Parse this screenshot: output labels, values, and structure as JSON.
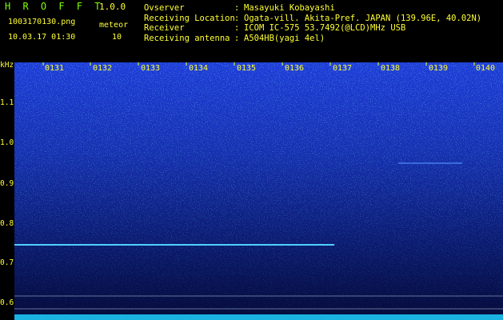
{
  "app": {
    "name": "H R O F F T",
    "version": "1.0.0"
  },
  "file": {
    "name": "1003170130.png",
    "datetime": "10.03.17 01:30"
  },
  "meteor": {
    "label": "meteor",
    "count": "10"
  },
  "info": [
    {
      "key": "Ovserver",
      "sep": ":",
      "value": "Masayuki Kobayashi"
    },
    {
      "key": "Receiving Location",
      "sep": ":",
      "value": "Ogata-vill. Akita-Pref. JAPAN (139.96E, 40.02N)"
    },
    {
      "key": "Receiver",
      "sep": ":",
      "value": "ICOM IC-575 53.7492(@LCD)MHz USB"
    },
    {
      "key": "Receiving antenna",
      "sep": ":",
      "value": "A504HB(yagi 4el)"
    }
  ],
  "yaxis": {
    "unit": "kHz",
    "ticks": [
      "1.1",
      "1.0",
      "0.9",
      "0.8",
      "0.7",
      "0.6"
    ]
  },
  "xaxis": {
    "ticks": [
      "0131",
      "0132",
      "0133",
      "0134",
      "0135",
      "0136",
      "0137",
      "0138",
      "0139",
      "0140"
    ]
  },
  "colors": {
    "text": "#ffff33",
    "title": "#7fff00",
    "line": "#4fd0ff"
  }
}
